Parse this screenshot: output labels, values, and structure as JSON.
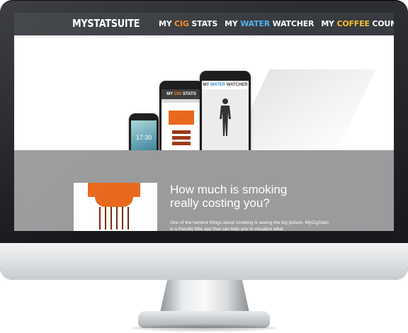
{
  "site": {
    "logo": "MYSTATSUITE",
    "nav": [
      {
        "prefix": "MY ",
        "accent": "CIG",
        "suffix": " STATS",
        "accent_color": "#ff8a2a"
      },
      {
        "prefix": "MY ",
        "accent": "WATER",
        "suffix": " WATCHER",
        "accent_color": "#52b4ef"
      },
      {
        "prefix": "MY ",
        "accent": "COFFEE",
        "suffix": " COUNTER",
        "accent_color": "#f6c033"
      }
    ]
  },
  "hero": {
    "phone1_time": "17:30",
    "phone2_title_prefix": "MY ",
    "phone2_title_accent": "CIG",
    "phone2_title_suffix": " STATS",
    "phone3_title_prefix": "MY ",
    "phone3_title_accent": "WATER",
    "phone3_title_suffix": " WATCHER"
  },
  "feature": {
    "headline_line1": "How much is smoking",
    "headline_line2": "really costing you?",
    "body": "One of the hardest things about smoking is seeing the big picture. MyCigStats is a friendly little app that can help you to visualize what"
  },
  "colors": {
    "nav_bg": "#383b3f",
    "cig_orange": "#e8691d",
    "water_blue": "#3a98d8",
    "section_gray": "#9a9b9c"
  }
}
